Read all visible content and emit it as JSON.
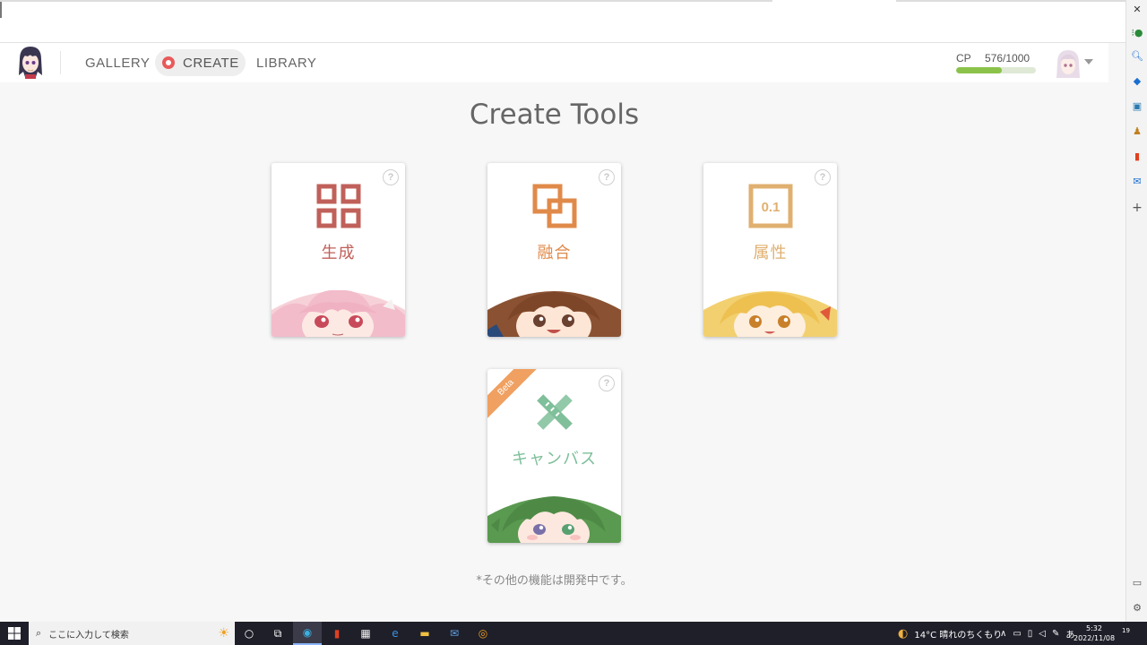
{
  "nav": {
    "gallery": "GALLERY",
    "create": "CREATE",
    "library": "LIBRARY"
  },
  "cp": {
    "label": "CP",
    "value": "576/1000",
    "fraction": 0.576,
    "bar_color": "#8bc34a"
  },
  "main": {
    "title": "Create Tools",
    "footnote": "*その他の機能は開発中です。"
  },
  "tools": [
    {
      "label": "生成",
      "color": "#c0605a",
      "icon": "grid-icon"
    },
    {
      "label": "融合",
      "color": "#e08a4a",
      "icon": "merge-icon"
    },
    {
      "label": "属性",
      "color": "#e0b070",
      "icon": "attribute-icon",
      "icon_text": "0.1"
    },
    {
      "label": "キャンバス",
      "color": "#7fbf9a",
      "icon": "pencil-ruler-icon",
      "badge": "Beta"
    }
  ],
  "help_glyph": "?",
  "taskbar": {
    "search_placeholder": "ここに入力して検索",
    "weather": "14°C  晴れのちくもり",
    "time": "5:32",
    "date": "2022/11/08",
    "ime": "あ",
    "notify_count": "19"
  }
}
